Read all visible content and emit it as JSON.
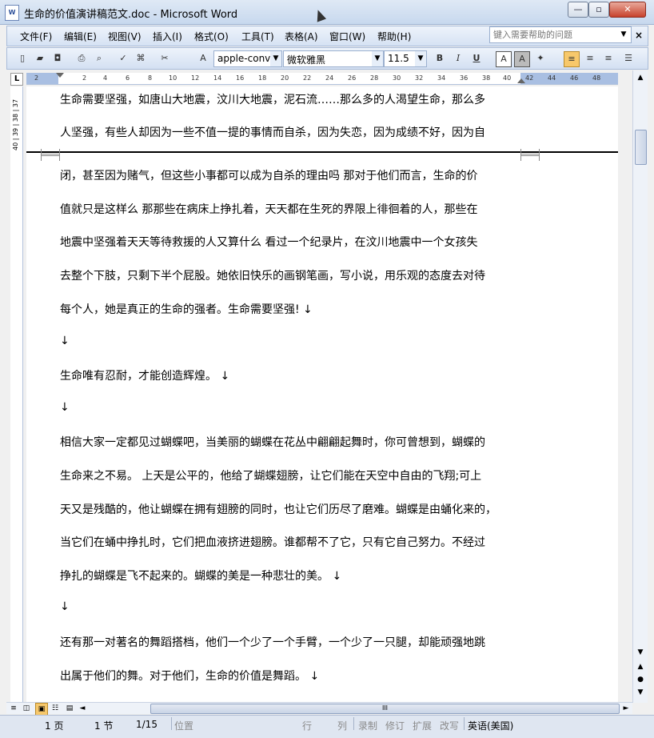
{
  "window": {
    "title": "生命的价值演讲稿范文.doc - Microsoft Word",
    "app_icon_glyph": "W",
    "minimize_glyph": "—",
    "maximize_glyph": "▫",
    "close_glyph": "✕"
  },
  "menu": {
    "items": [
      {
        "label": "文件(F)"
      },
      {
        "label": "编辑(E)"
      },
      {
        "label": "视图(V)"
      },
      {
        "label": "插入(I)"
      },
      {
        "label": "格式(O)"
      },
      {
        "label": "工具(T)"
      },
      {
        "label": "表格(A)"
      },
      {
        "label": "窗口(W)"
      },
      {
        "label": "帮助(H)"
      }
    ],
    "help_placeholder": "键入需要帮助的问题",
    "help_drop_glyph": "▼",
    "doc_close_glyph": "×"
  },
  "toolbar": {
    "style_value": "apple-conv",
    "font_value": "微软雅黑",
    "size_value": "11.5",
    "drop_glyph": "▼",
    "bold": "B",
    "italic": "I",
    "underline": "U",
    "font_color": "A",
    "highlight": "A"
  },
  "ruler": {
    "corner_glyph": "L",
    "ticks": [
      "2",
      "2",
      "4",
      "6",
      "8",
      "10",
      "12",
      "14",
      "16",
      "18",
      "20",
      "22",
      "24",
      "26",
      "28",
      "30",
      "32",
      "34",
      "36",
      "38",
      "40",
      "42",
      "44",
      "46",
      "48"
    ],
    "vertical_label": "40 | 39 | 38 | 37"
  },
  "document": {
    "paragraphs": [
      "生命需要坚强，如唐山大地震，汶川大地震，泥石流……那么多的人渴望生命，那么多",
      "人坚强，有些人却因为一些不值一提的事情而自杀，因为失恋，因为成绩不好，因为自",
      "闭，甚至因为赌气，但这些小事都可以成为自杀的理由吗 那对于他们而言，生命的价",
      "值就只是这样么 那那些在病床上挣扎着，天天都在生死的界限上徘徊着的人，那些在",
      "地震中坚强着天天等待救援的人又算什么 看过一个纪录片，在汶川地震中一个女孩失",
      "去整个下肢，只剩下半个屁股。她依旧快乐的画钢笔画，写小说，用乐观的态度去对待",
      "每个人，她是真正的生命的强者。生命需要坚强! ↓",
      "↓",
      "生命唯有忍耐，才能创造辉煌。 ↓",
      "↓",
      "相信大家一定都见过蝴蝶吧，当美丽的蝴蝶在花丛中翩翩起舞时，你可曾想到，蝴蝶的",
      "生命来之不易。 上天是公平的，他给了蝴蝶翅膀，让它们能在天空中自由的飞翔;可上",
      "天又是残酷的，他让蝴蝶在拥有翅膀的同时，也让它们历尽了磨难。蝴蝶是由蛹化来的，",
      "当它们在蛹中挣扎时，它们把血液挤进翅膀。谁都帮不了它，只有它自己努力。不经过",
      "挣扎的蝴蝶是飞不起来的。蝴蝶的美是一种悲壮的美。 ↓",
      "↓",
      "还有那一对著名的舞蹈搭档，他们一个少了一个手臂，一个少了一只腿，却能顽强地跳",
      "出属于他们的舞。对于他们，生命的价值是舞蹈。 ↓"
    ]
  },
  "scroll": {
    "up_glyph": "▲",
    "down_glyph": "▼",
    "prev_page_glyph": "▲",
    "select_browse_glyph": "●",
    "next_page_glyph": "▼",
    "hthumb_grip": "III",
    "left_glyph": "◄",
    "right_glyph": "►"
  },
  "status": {
    "page": "1 页",
    "section": "1 节",
    "page_of": "1/15",
    "position": "位置",
    "line": "行",
    "col": "列",
    "rec": "录制",
    "trk": "修订",
    "ext": "扩展",
    "ovr": "改写",
    "lang": "英语(美国)"
  }
}
